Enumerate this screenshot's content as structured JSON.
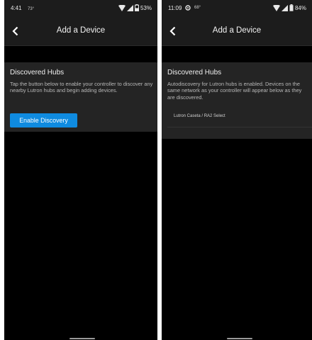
{
  "screens": [
    {
      "status": {
        "time": "4:41",
        "temp": "73°",
        "battery": "53%"
      },
      "title": "Add a Device",
      "section": {
        "heading": "Discovered Hubs",
        "description": "Tap the button below to enable your controller to discover any nearby Lutron hubs and begin adding devices.",
        "button_label": "Enable Discovery"
      }
    },
    {
      "status": {
        "time": "11:09",
        "temp": "68°",
        "battery": "84%"
      },
      "title": "Add a Device",
      "section": {
        "heading": "Discovered Hubs",
        "description": "Autodiscovery for Lutron hubs is enabled. Devices on the same network as your controller will appear below as they are discovered.",
        "hubs": [
          "Lutron Caseta / RA2 Select"
        ]
      }
    }
  ],
  "colors": {
    "accent": "#0f8be0",
    "background": "#000000",
    "surface": "#242424"
  },
  "icons": [
    "back-arrow-icon",
    "wifi-icon",
    "signal-icon",
    "battery-icon",
    "weather-icon"
  ]
}
